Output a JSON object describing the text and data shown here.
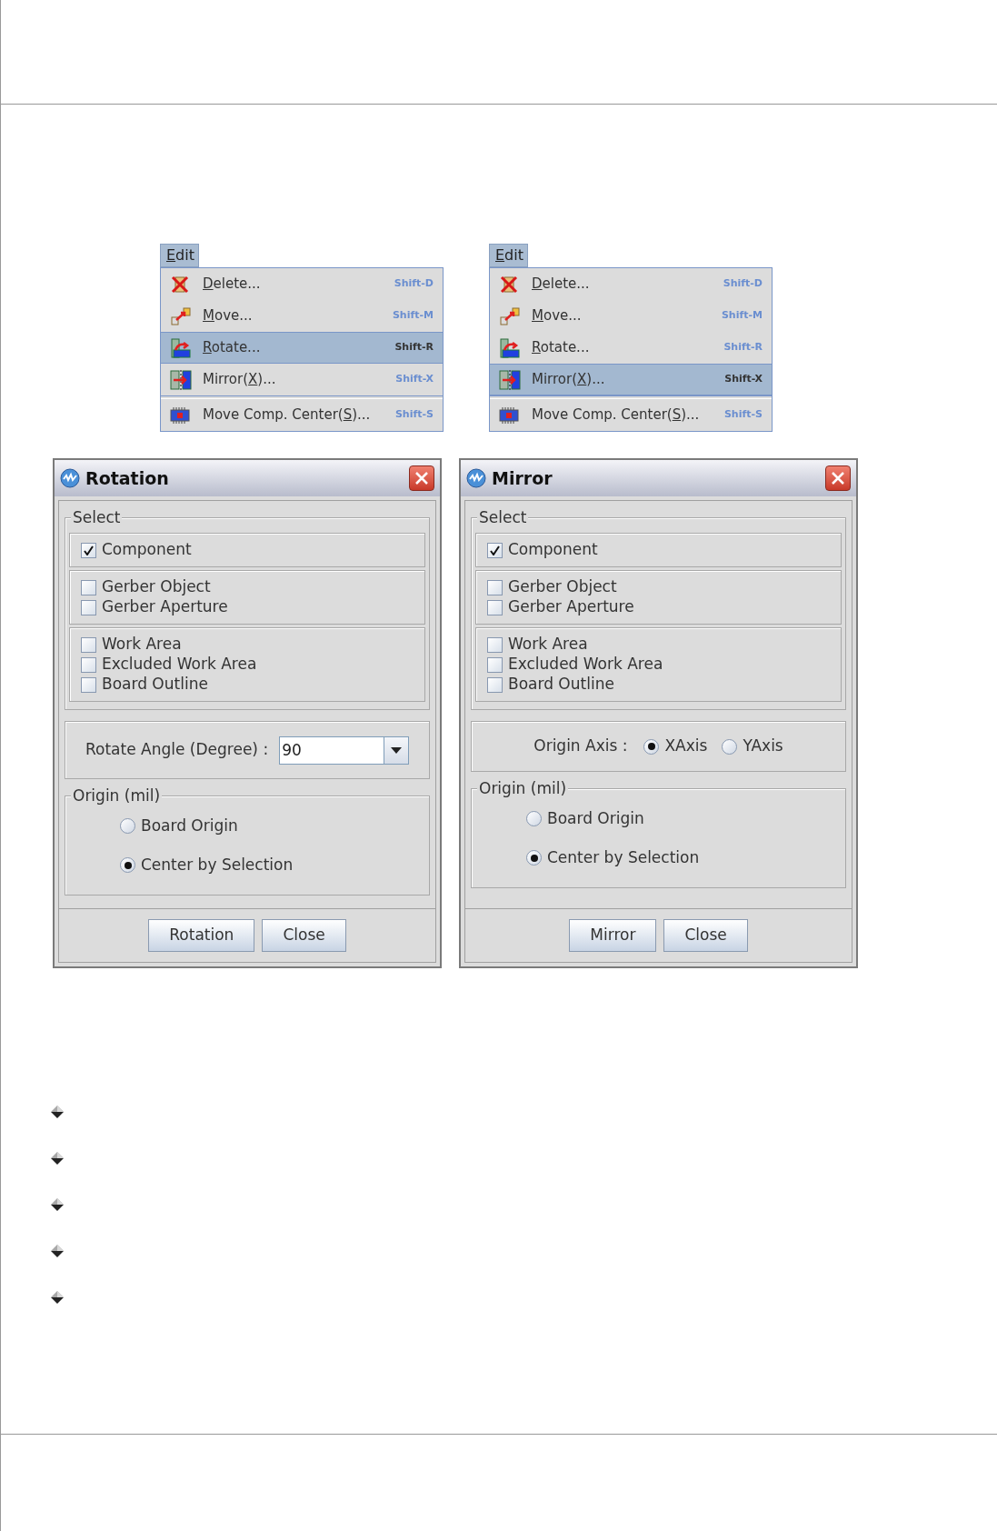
{
  "menus": [
    {
      "title": {
        "key": "E",
        "post": "dit"
      },
      "items": [
        {
          "key": "D",
          "post": "elete...",
          "shortcut": "Shift-D",
          "selected": false,
          "separator_before": false
        },
        {
          "key": "M",
          "post": "ove...",
          "shortcut": "Shift-M",
          "selected": false,
          "separator_before": false
        },
        {
          "key": "R",
          "post": "otate...",
          "shortcut": "Shift-R",
          "selected": true,
          "separator_before": false
        },
        {
          "pre": "Mirror(",
          "key": "X",
          "post": ")...",
          "shortcut": "Shift-X",
          "selected": false,
          "separator_before": false
        },
        {
          "pre": "Move Comp. Center(",
          "key": "S",
          "post": ")...",
          "shortcut": "Shift-S",
          "selected": false,
          "separator_before": true
        }
      ]
    },
    {
      "title": {
        "key": "E",
        "post": "dit"
      },
      "items": [
        {
          "key": "D",
          "post": "elete...",
          "shortcut": "Shift-D",
          "selected": false,
          "separator_before": false
        },
        {
          "key": "M",
          "post": "ove...",
          "shortcut": "Shift-M",
          "selected": false,
          "separator_before": false
        },
        {
          "key": "R",
          "post": "otate...",
          "shortcut": "Shift-R",
          "selected": false,
          "separator_before": false
        },
        {
          "pre": "Mirror(",
          "key": "X",
          "post": ")...",
          "shortcut": "Shift-X",
          "selected": true,
          "separator_before": false
        },
        {
          "pre": "Move Comp. Center(",
          "key": "S",
          "post": ")...",
          "shortcut": "Shift-S",
          "selected": false,
          "separator_before": true
        }
      ]
    }
  ],
  "dialogs": [
    {
      "title": "Rotation",
      "select_label": "Select",
      "groups": [
        {
          "items": [
            {
              "label": "Component",
              "checked": true
            }
          ]
        },
        {
          "items": [
            {
              "label": "Gerber Object",
              "checked": false
            },
            {
              "label": "Gerber Aperture",
              "checked": false
            }
          ]
        },
        {
          "items": [
            {
              "label": "Work Area",
              "checked": false
            },
            {
              "label": "Excluded Work Area",
              "checked": false
            },
            {
              "label": "Board Outline",
              "checked": false
            }
          ]
        }
      ],
      "middle": {
        "kind": "angle",
        "label": "Rotate Angle (Degree) :",
        "value": "90"
      },
      "origin_label": "Origin (mil)",
      "origin_options": [
        {
          "label": "Board Origin",
          "selected": false
        },
        {
          "label": "Center by Selection",
          "selected": true
        }
      ],
      "buttons": [
        "Rotation",
        "Close"
      ]
    },
    {
      "title": "Mirror",
      "select_label": "Select",
      "groups": [
        {
          "items": [
            {
              "label": "Component",
              "checked": true
            }
          ]
        },
        {
          "items": [
            {
              "label": "Gerber Object",
              "checked": false
            },
            {
              "label": "Gerber Aperture",
              "checked": false
            }
          ]
        },
        {
          "items": [
            {
              "label": "Work Area",
              "checked": false
            },
            {
              "label": "Excluded Work Area",
              "checked": false
            },
            {
              "label": "Board Outline",
              "checked": false
            }
          ]
        }
      ],
      "middle": {
        "kind": "axis",
        "label": "Origin Axis :",
        "options": [
          {
            "label": "XAxis",
            "selected": true
          },
          {
            "label": "YAxis",
            "selected": false
          }
        ]
      },
      "origin_label": "Origin (mil)",
      "origin_options": [
        {
          "label": "Board Origin",
          "selected": false
        },
        {
          "label": "Center by Selection",
          "selected": true
        }
      ],
      "buttons": [
        "Mirror",
        "Close"
      ]
    }
  ],
  "bullets": [
    {
      "kind": "diamond"
    },
    {
      "kind": "diamond"
    },
    {
      "kind": "diamond"
    },
    {
      "kind": "diamond"
    },
    {
      "kind": "diamond"
    }
  ]
}
